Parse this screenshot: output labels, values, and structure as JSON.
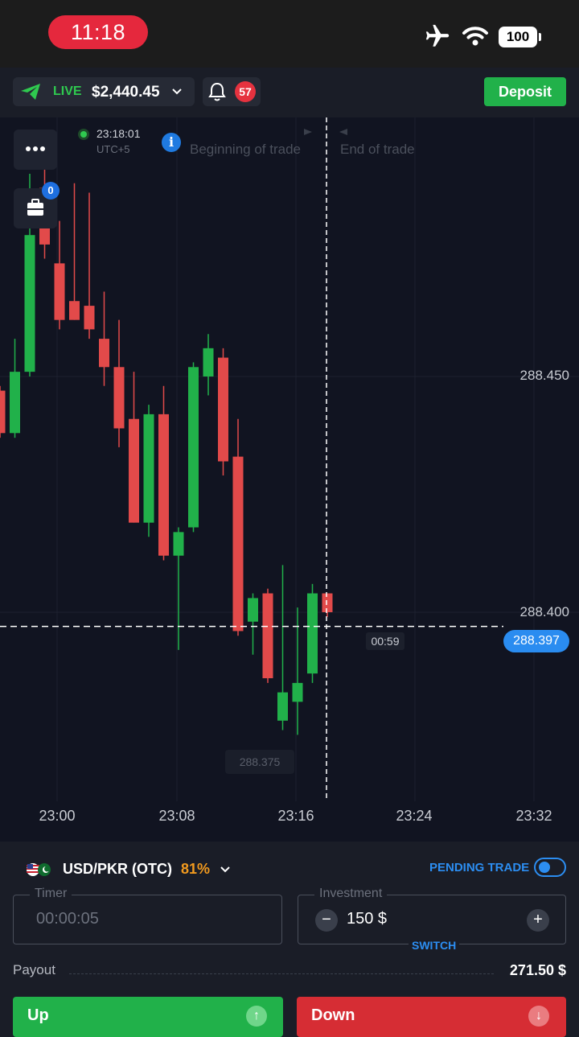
{
  "status_bar": {
    "time": "11:18",
    "battery": "100",
    "icons": [
      "airplane-icon",
      "wifi-icon",
      "battery-icon"
    ]
  },
  "header": {
    "account_mode": "LIVE",
    "balance": "$2,440.45",
    "notifications": "57",
    "deposit_label": "Deposit"
  },
  "chart": {
    "server_time": "23:18:01",
    "timezone": "UTC+5",
    "beginning_label": "Beginning of trade",
    "end_label": "End of trade",
    "open_trades": "0",
    "countdown": "00:59",
    "current_price": "288.397",
    "low_marker": "288.375",
    "colors": {
      "up": "#21b14a",
      "down": "#e24a4a",
      "accent": "#2a8cf0"
    }
  },
  "chart_data": {
    "type": "candlestick",
    "price_ticks": [
      "288.450",
      "288.400"
    ],
    "time_ticks": [
      "23:00",
      "23:08",
      "23:16",
      "23:24",
      "23:32"
    ],
    "candles": [
      {
        "dir": "down",
        "open": 288.447,
        "close": 288.438,
        "high": 288.448,
        "low": 288.437
      },
      {
        "dir": "up",
        "open": 288.438,
        "close": 288.451,
        "high": 288.458,
        "low": 288.437
      },
      {
        "dir": "up",
        "open": 288.451,
        "close": 288.48,
        "high": 288.493,
        "low": 288.45
      },
      {
        "dir": "down",
        "open": 288.49,
        "close": 288.478,
        "high": 288.497,
        "low": 288.475
      },
      {
        "dir": "down",
        "open": 288.474,
        "close": 288.462,
        "high": 288.483,
        "low": 288.46
      },
      {
        "dir": "down",
        "open": 288.466,
        "close": 288.462,
        "high": 288.491,
        "low": 288.462
      },
      {
        "dir": "down",
        "open": 288.465,
        "close": 288.46,
        "high": 288.489,
        "low": 288.458
      },
      {
        "dir": "down",
        "open": 288.458,
        "close": 288.452,
        "high": 288.468,
        "low": 288.448
      },
      {
        "dir": "down",
        "open": 288.452,
        "close": 288.439,
        "high": 288.462,
        "low": 288.435
      },
      {
        "dir": "down",
        "open": 288.441,
        "close": 288.419,
        "high": 288.451,
        "low": 288.419
      },
      {
        "dir": "up",
        "open": 288.419,
        "close": 288.442,
        "high": 288.444,
        "low": 288.416
      },
      {
        "dir": "down",
        "open": 288.442,
        "close": 288.412,
        "high": 288.448,
        "low": 288.411
      },
      {
        "dir": "up",
        "open": 288.412,
        "close": 288.417,
        "high": 288.418,
        "low": 288.392
      },
      {
        "dir": "up",
        "open": 288.418,
        "close": 288.452,
        "high": 288.453,
        "low": 288.417
      },
      {
        "dir": "up",
        "open": 288.45,
        "close": 288.456,
        "high": 288.459,
        "low": 288.446
      },
      {
        "dir": "down",
        "open": 288.454,
        "close": 288.432,
        "high": 288.456,
        "low": 288.429
      },
      {
        "dir": "down",
        "open": 288.433,
        "close": 288.396,
        "high": 288.441,
        "low": 288.395
      },
      {
        "dir": "up",
        "open": 288.398,
        "close": 288.403,
        "high": 288.404,
        "low": 288.391
      },
      {
        "dir": "down",
        "open": 288.404,
        "close": 288.386,
        "high": 288.405,
        "low": 288.385
      },
      {
        "dir": "up",
        "open": 288.377,
        "close": 288.383,
        "high": 288.41,
        "low": 288.375
      },
      {
        "dir": "up",
        "open": 288.381,
        "close": 288.385,
        "high": 288.401,
        "low": 288.374
      },
      {
        "dir": "up",
        "open": 288.387,
        "close": 288.404,
        "high": 288.406,
        "low": 288.385
      },
      {
        "dir": "down",
        "open": 288.404,
        "close": 288.4,
        "high": 288.404,
        "low": 288.399
      }
    ]
  },
  "asset": {
    "pair": "USD/PKR (OTC)",
    "payout_percent": "81%",
    "pending_trade_label": "PENDING TRADE"
  },
  "order": {
    "timer_label": "Timer",
    "timer_value": "00:00:05",
    "investment_label": "Investment",
    "investment_value": "150 $",
    "minus": "−",
    "plus": "+",
    "switch_label": "SWITCH",
    "payout_label": "Payout",
    "payout_value": "271.50 $",
    "up_label": "Up",
    "down_label": "Down"
  }
}
